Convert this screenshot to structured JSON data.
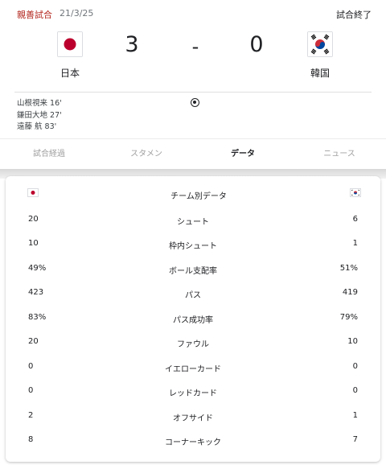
{
  "match": {
    "competition": "親善試合",
    "date": "21/3/25",
    "status": "試合終了",
    "home": {
      "name": "日本",
      "score": "3"
    },
    "away": {
      "name": "韓国",
      "score": "0"
    },
    "separator": "-"
  },
  "scorers": [
    "山根視来 16'",
    "鎌田大地 27'",
    "遠藤 航 83'"
  ],
  "tabs": [
    "試合経過",
    "スタメン",
    "データ",
    "ニュース"
  ],
  "active_tab": "データ",
  "stats": {
    "title": "チーム別データ",
    "rows": [
      {
        "label": "シュート",
        "home": "20",
        "away": "6"
      },
      {
        "label": "枠内シュート",
        "home": "10",
        "away": "1"
      },
      {
        "label": "ボール支配率",
        "home": "49%",
        "away": "51%"
      },
      {
        "label": "パス",
        "home": "423",
        "away": "419"
      },
      {
        "label": "パス成功率",
        "home": "83%",
        "away": "79%"
      },
      {
        "label": "ファウル",
        "home": "20",
        "away": "10"
      },
      {
        "label": "イエローカード",
        "home": "0",
        "away": "0"
      },
      {
        "label": "レッドカード",
        "home": "0",
        "away": "0"
      },
      {
        "label": "オフサイド",
        "home": "2",
        "away": "1"
      },
      {
        "label": "コーナーキック",
        "home": "8",
        "away": "7"
      }
    ]
  },
  "icons": {
    "home_flag": "japan-flag-icon",
    "away_flag": "korea-flag-icon",
    "goal": "soccer-ball-icon"
  },
  "colors": {
    "competition": "#b3261e",
    "japan_red": "#bc002d",
    "korea_red": "#cd2e3a",
    "korea_blue": "#0047a0"
  }
}
